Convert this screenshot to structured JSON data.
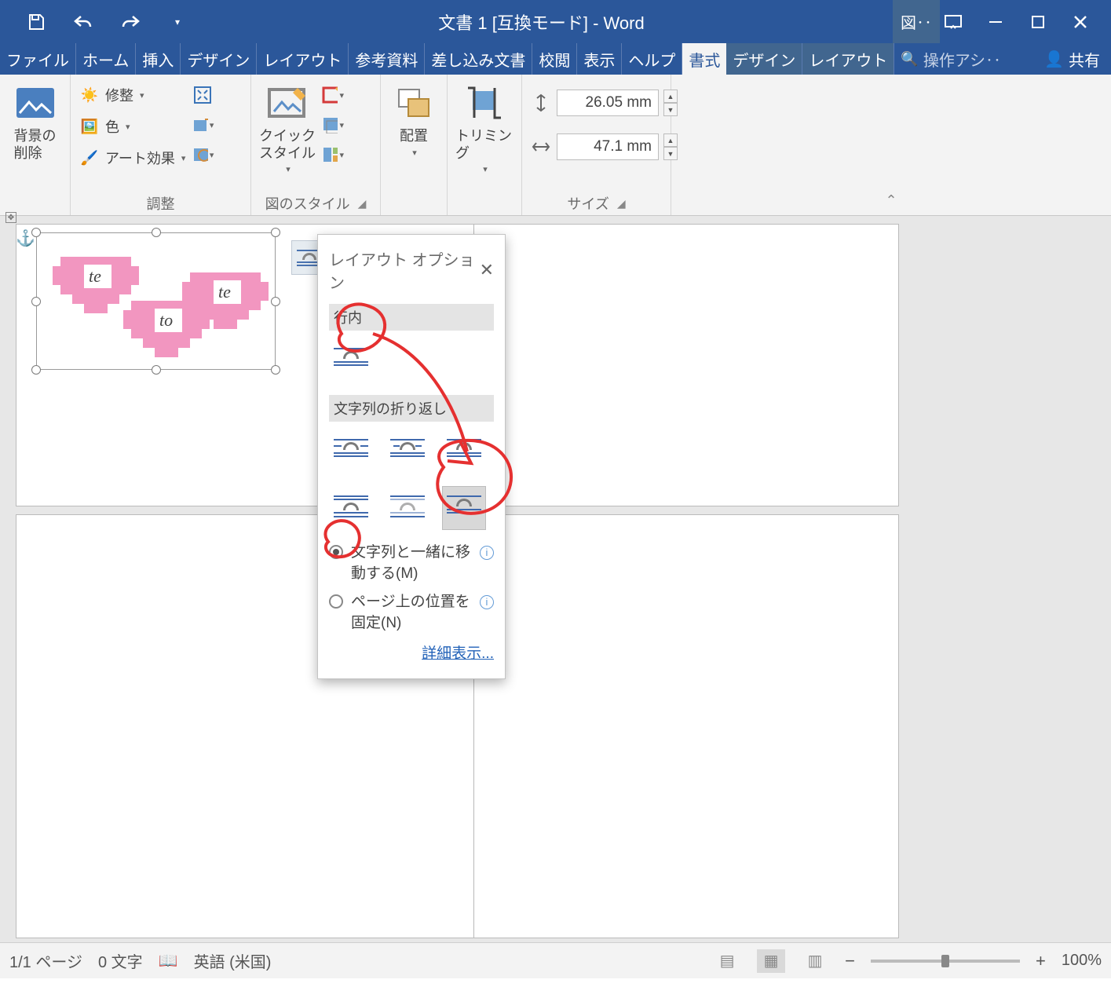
{
  "title": "文書 1 [互換モード]  -  Word",
  "picturetools_tab": "図‥",
  "tabs": [
    "ファイル",
    "ホーム",
    "挿入",
    "デザイン",
    "レイアウト",
    "参考資料",
    "差し込み文書",
    "校閲",
    "表示",
    "ヘルプ",
    "書式",
    "デザイン",
    "レイアウト"
  ],
  "tabs_active_index": 10,
  "search": {
    "placeholder": "操作アシ‥"
  },
  "share": "共有",
  "ribbon": {
    "remove_bg": "背景の\n削除",
    "corrections": "修整",
    "color": "色",
    "artistic": "アート効果",
    "group_adjust": "調整",
    "quick_styles": "クイック\nスタイル",
    "group_styles": "図のスタイル",
    "arrange": "配置",
    "crop": "トリミング",
    "group_size": "サイズ",
    "height": "26.05 mm",
    "width": "47.1 mm"
  },
  "picture": {
    "labels": [
      "te",
      "to",
      "te"
    ]
  },
  "popup": {
    "title": "レイアウト オプション",
    "section_inline": "行内",
    "section_wrap": "文字列の折り返し",
    "radio_move_with_text": "文字列と一緒に移動する(M)",
    "radio_fix_position": "ページ上の位置を固定(N)",
    "more": "詳細表示..."
  },
  "status": {
    "page": "1/1 ページ",
    "words": "0 文字",
    "lang": "英語 (米国)",
    "zoom": "100%"
  }
}
